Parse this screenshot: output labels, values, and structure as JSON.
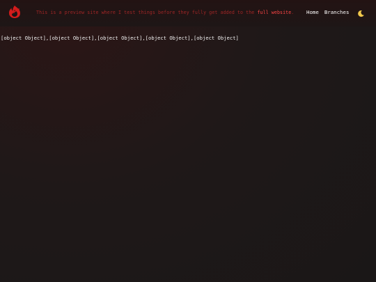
{
  "header": {
    "logo_icon": "flame-logo-icon",
    "notice_text": "This is a preview site where I test things before they fully get added to the ",
    "notice_link": "full website",
    "notice_end": ".",
    "nav": {
      "home": "Home",
      "branches": "Branches"
    },
    "theme_icon": "crescent-moon-icon"
  },
  "main": {
    "text": "[object Object],[object Object],[object Object],[object Object],[object Object]"
  },
  "colors": {
    "background": "#1e1818",
    "notice": "#a02626",
    "link": "#ff4646",
    "logo": "#d41c1c"
  }
}
